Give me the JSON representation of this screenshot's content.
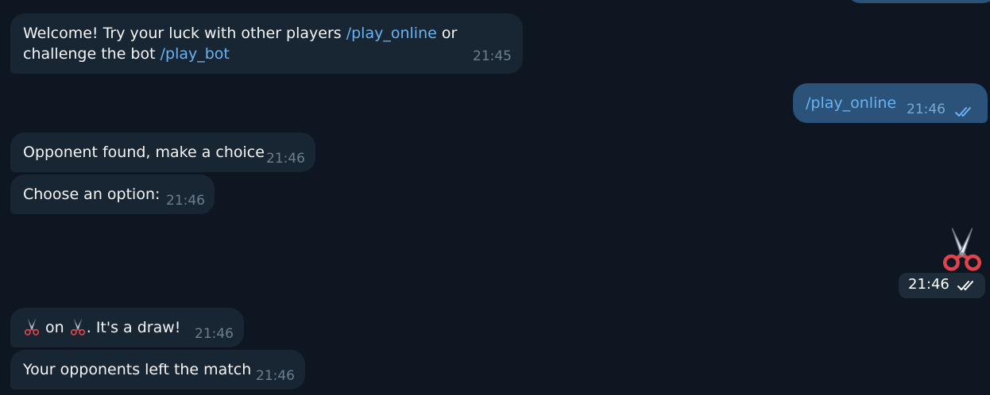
{
  "colors": {
    "background": "#0e1621",
    "incoming_bubble": "#182533",
    "outgoing_bubble": "#2b5278",
    "link": "#6ab3f3",
    "time_in": "#6d7f8f"
  },
  "messages": {
    "welcome": {
      "text_a": "Welcome! Try your luck with other players ",
      "link_a": "/play_online",
      "text_b": " or challenge the bot ",
      "link_b": "/play_bot",
      "time": "21:45"
    },
    "sent_play_online": {
      "text": "/play_online",
      "time": "21:46",
      "status_icon": "double-check-icon"
    },
    "opponent_found": {
      "text": "Opponent found, make a choice",
      "time": "21:46"
    },
    "choose_option": {
      "text": "Choose an option:",
      "time": "21:46"
    },
    "sent_emoji": {
      "emoji_icon": "scissors-icon",
      "time": "21:46",
      "status_icon": "double-check-icon"
    },
    "draw": {
      "text_on": " on ",
      "text_rest": ". It's a draw!",
      "time": "21:46",
      "icon": "scissors-icon"
    },
    "opponent_left": {
      "text": "Your opponents left the match",
      "time": "21:46"
    }
  }
}
